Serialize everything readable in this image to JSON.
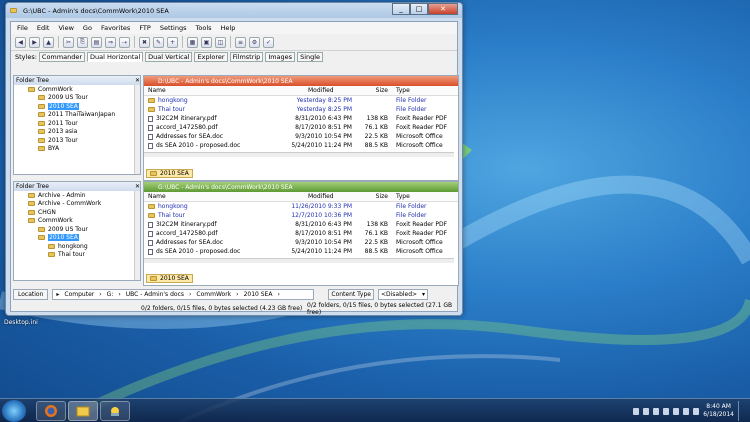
{
  "window": {
    "title": "G:\\UBC - Admin's docs\\CommWork\\2010 SEA"
  },
  "menu": [
    "File",
    "Edit",
    "View",
    "Go",
    "Favorites",
    "FTP",
    "Settings",
    "Tools",
    "Help"
  ],
  "styles": {
    "label": "Styles:",
    "tabs": [
      "Commander",
      "Dual Horizontal",
      "Dual Vertical",
      "Explorer",
      "Filmstrip",
      "Images",
      "Single"
    ],
    "active_index": 1
  },
  "tree_top": {
    "header": "Folder Tree",
    "items": [
      {
        "label": "CommWork",
        "indent": 1
      },
      {
        "label": "2009 US Tour",
        "indent": 2
      },
      {
        "label": "2010 SEA",
        "indent": 2,
        "selected": true
      },
      {
        "label": "2011 ThaiTaiwanJapan",
        "indent": 2
      },
      {
        "label": "2011 Tour",
        "indent": 2
      },
      {
        "label": "2013 asia",
        "indent": 2
      },
      {
        "label": "2013 Tour",
        "indent": 2
      },
      {
        "label": "BYA",
        "indent": 2
      }
    ]
  },
  "tree_bottom": {
    "header": "Folder Tree",
    "items": [
      {
        "label": "Archive - Admin",
        "indent": 1
      },
      {
        "label": "Archive - CommWork",
        "indent": 1
      },
      {
        "label": "CHGN",
        "indent": 1
      },
      {
        "label": "CommWork",
        "indent": 1
      },
      {
        "label": "2009 US Tour",
        "indent": 2
      },
      {
        "label": "2010 SEA",
        "indent": 2,
        "selected": true
      },
      {
        "label": "hongkong",
        "indent": 3
      },
      {
        "label": "Thai tour",
        "indent": 3
      }
    ]
  },
  "pane_top": {
    "path": "D:\\UBC - Admin's docs\\CommWork\\2010 SEA",
    "columns": [
      "Name",
      "Modified",
      "Size",
      "Type"
    ],
    "rows": [
      {
        "name": "hongkong",
        "modified": "Yesterday 8:25 PM",
        "size": "",
        "type": "File Folder",
        "folder": true
      },
      {
        "name": "Thai tour",
        "modified": "Yesterday 8:25 PM",
        "size": "",
        "type": "File Folder",
        "folder": true
      },
      {
        "name": "3I2C2M itinerary.pdf",
        "modified": "8/31/2010 6:43 PM",
        "size": "138 KB",
        "type": "Foxit Reader PDF"
      },
      {
        "name": "accord_1472580.pdf",
        "modified": "8/17/2010 8:51 PM",
        "size": "76.1 KB",
        "type": "Foxit Reader PDF"
      },
      {
        "name": "Addresses for SEA.doc",
        "modified": "9/3/2010 10:54 PM",
        "size": "22.5 KB",
        "type": "Microsoft Office"
      },
      {
        "name": "ds SEA 2010 - proposed.doc",
        "modified": "5/24/2010 11:24 PM",
        "size": "88.5 KB",
        "type": "Microsoft Office"
      }
    ],
    "crumb": "2010 SEA"
  },
  "pane_bottom": {
    "path": "G:\\UBC - Admin's docs\\CommWork\\2010 SEA",
    "columns": [
      "Name",
      "Modified",
      "Size",
      "Type"
    ],
    "rows": [
      {
        "name": "hongkong",
        "modified": "11/26/2010 9:33 PM",
        "size": "",
        "type": "File Folder",
        "folder": true
      },
      {
        "name": "Thai tour",
        "modified": "12/7/2010 10:36 PM",
        "size": "",
        "type": "File Folder",
        "folder": true
      },
      {
        "name": "3I2C2M itinerary.pdf",
        "modified": "8/31/2010 6:43 PM",
        "size": "138 KB",
        "type": "Foxit Reader PDF"
      },
      {
        "name": "accord_1472580.pdf",
        "modified": "8/17/2010 8:51 PM",
        "size": "76.1 KB",
        "type": "Foxit Reader PDF"
      },
      {
        "name": "Addresses for SEA.doc",
        "modified": "9/3/2010 10:54 PM",
        "size": "22.5 KB",
        "type": "Microsoft Office"
      },
      {
        "name": "ds SEA 2010 - proposed.doc",
        "modified": "5/24/2010 11:24 PM",
        "size": "88.5 KB",
        "type": "Microsoft Office"
      }
    ],
    "crumb": "2010 SEA"
  },
  "location": {
    "label": "Location",
    "crumbs": [
      "Computer",
      "G:",
      "UBC - Admin's docs",
      "CommWork",
      "2010 SEA"
    ],
    "content_type_label": "Content Type",
    "content_type_value": "<Disabled>"
  },
  "status": {
    "left": "0/2 folders, 0/15 files, 0 bytes selected (4.23 GB free)",
    "right": "0/2 folders, 0/15 files, 0 bytes selected (27.1 GB free)"
  },
  "desktop_icon_label": "Desktop.ini",
  "clock": {
    "time": "8:40 AM",
    "date": "6/18/2014"
  }
}
